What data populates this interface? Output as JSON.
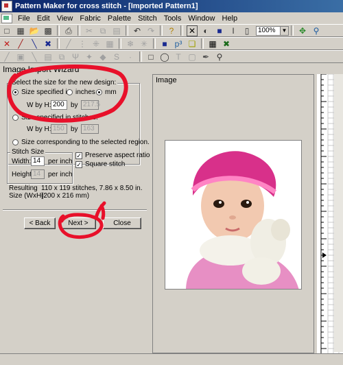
{
  "window": {
    "title": "Pattern Maker for cross stitch - [Imported Pattern1]"
  },
  "menu": [
    "File",
    "Edit",
    "View",
    "Fabric",
    "Palette",
    "Stitch",
    "Tools",
    "Window",
    "Help"
  ],
  "toolbar": {
    "zoom": "100%"
  },
  "wizard": {
    "title": "Image Import Wizard",
    "size_group_label": "Select the size for the new design:",
    "opt_size_specified_in": "Size specified in:",
    "unit_inches": "inches",
    "unit_mm": "mm",
    "w_by_h_label": "W by H:",
    "width_mm": "200",
    "by_label": "by",
    "height_mm": "217.5",
    "opt_size_in_stitches": "Size specified in stitches:",
    "w_by_h_label2": "W by H:",
    "width_stitches": "150",
    "by_label2": "by",
    "height_stitches": "163",
    "opt_selected_region": "Size corresponding to the selected region.",
    "stitch_size_label": "Stitch Size",
    "width_label": "Width:",
    "width_per_inch": "14",
    "per_inch_1": "per inch",
    "height_label": "Height:",
    "height_per_inch": "14",
    "per_inch_2": "per inch",
    "preserve_aspect": "Preserve aspect ratio",
    "square_stitch": "Square stitch",
    "resulting_label_1": "Resulting",
    "resulting_label_2": "Size (WxH):",
    "result_line_1": "110 x 119 stitches,  7.86 x 8.50 in.",
    "result_line_2": "(200 x 216 mm)",
    "back_button": "< Back",
    "next_button": "Next >",
    "close_button": "Close"
  },
  "image_panel": {
    "label": "Image"
  },
  "colors": {
    "annotation": "#e8102a",
    "titlebar": "#0a246a"
  }
}
